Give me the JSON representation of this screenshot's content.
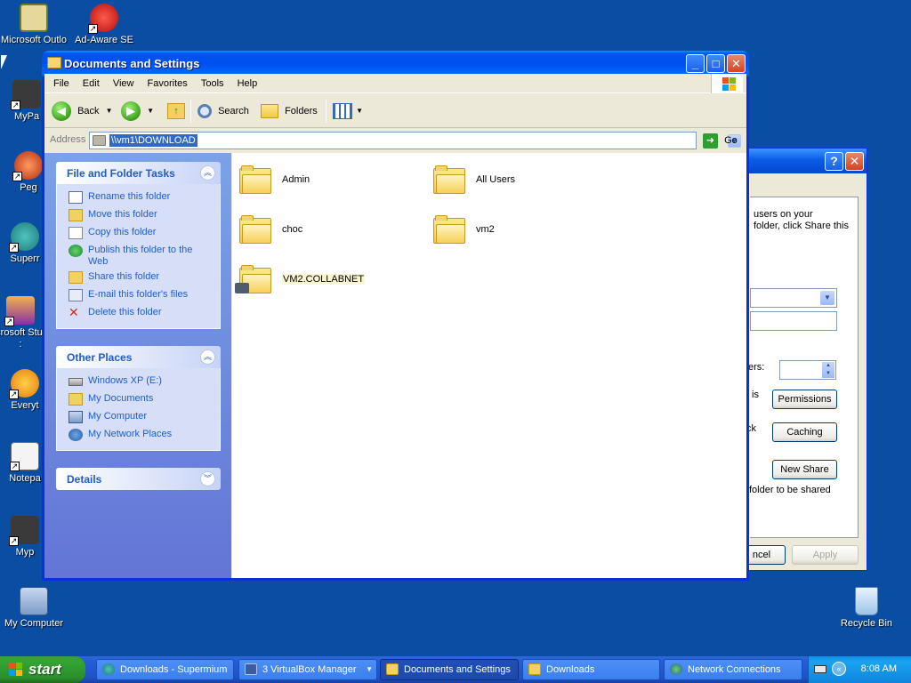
{
  "desktop": {
    "icons": [
      {
        "label": "Microsoft Outlo",
        "icon": "outlook-icon"
      },
      {
        "label": "Ad-Aware SE",
        "icon": "adaware-icon"
      },
      {
        "label": "MyPa",
        "icon": "mypal-icon"
      },
      {
        "label": "Peg",
        "icon": "pegasus-icon"
      },
      {
        "label": "Superr",
        "icon": "supermium-icon"
      },
      {
        "label": "Microsoft Studio :",
        "icon": "visual-studio-icon"
      },
      {
        "label": "Everyt",
        "icon": "everything-icon"
      },
      {
        "label": "Notepa",
        "icon": "notepad-icon"
      },
      {
        "label": "Myp",
        "icon": "mypal-icon"
      },
      {
        "label": "My Computer",
        "icon": "computer-icon"
      },
      {
        "label": "Recycle Bin",
        "icon": "recycle-bin-icon"
      }
    ]
  },
  "window": {
    "title": "Documents and Settings",
    "menu": [
      "File",
      "Edit",
      "View",
      "Favorites",
      "Tools",
      "Help"
    ],
    "toolbar": {
      "back": "Back",
      "search": "Search",
      "folders": "Folders"
    },
    "address": {
      "label": "Address",
      "value": "\\\\vm1\\DOWNLOAD",
      "go": "Go"
    },
    "tasks": {
      "title": "File and Folder Tasks",
      "items": [
        {
          "label": "Rename this folder",
          "icon": "rename-icon"
        },
        {
          "label": "Move this folder",
          "icon": "move-icon"
        },
        {
          "label": "Copy this folder",
          "icon": "copy-icon"
        },
        {
          "label": "Publish this folder to the Web",
          "icon": "globe-icon"
        },
        {
          "label": "Share this folder",
          "icon": "share-icon"
        },
        {
          "label": "E-mail this folder's files",
          "icon": "email-icon"
        },
        {
          "label": "Delete this folder",
          "icon": "delete-icon"
        }
      ]
    },
    "other_places": {
      "title": "Other Places",
      "items": [
        {
          "label": "Windows XP (E:)",
          "icon": "drive-icon"
        },
        {
          "label": "My Documents",
          "icon": "documents-icon"
        },
        {
          "label": "My Computer",
          "icon": "computer-icon"
        },
        {
          "label": "My Network Places",
          "icon": "network-icon"
        }
      ]
    },
    "details": {
      "title": "Details"
    },
    "files": [
      {
        "name": "Admin"
      },
      {
        "name": "All Users"
      },
      {
        "name": "choc"
      },
      {
        "name": "vm2"
      },
      {
        "name": "VM2.COLLABNET"
      }
    ]
  },
  "background_dialog": {
    "text1": "users on your",
    "text2": "folder, click Share this",
    "users_label": "ers:",
    "is_text": "is",
    "ck_text": "ck",
    "permissions": "Permissions",
    "caching": "Caching",
    "new_share": "New Share",
    "folder_shared": "folder to be shared",
    "cancel": "ncel",
    "apply": "Apply"
  },
  "taskbar": {
    "start": "start",
    "items": [
      {
        "label": "Downloads - Supermium"
      },
      {
        "label": "3 VirtualBox Manager"
      },
      {
        "label": "Documents and Settings"
      },
      {
        "label": "Downloads"
      },
      {
        "label": "Network Connections"
      }
    ],
    "clock": "8:08 AM"
  }
}
